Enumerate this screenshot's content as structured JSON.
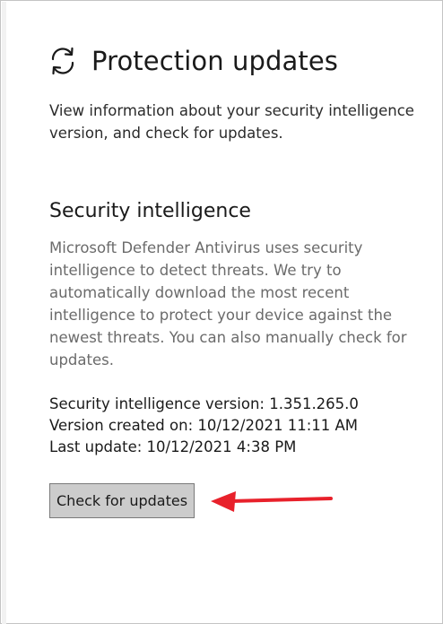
{
  "header": {
    "icon": "refresh-icon",
    "title": "Protection updates",
    "description": "View information about your security intelligence version, and check for updates."
  },
  "security_intelligence": {
    "heading": "Security intelligence",
    "description": "Microsoft Defender Antivirus uses security intelligence to detect threats. We try to automatically download the most recent intelligence to protect your device against the newest threats. You can also manually check for updates.",
    "version_line": "Security intelligence version: 1.351.265.0",
    "created_line": "Version created on: 10/12/2021 11:11 AM",
    "last_update_line": "Last update: 10/12/2021 4:38 PM",
    "check_button_label": "Check for updates"
  },
  "annotation": {
    "arrow_color": "#e8212b"
  }
}
